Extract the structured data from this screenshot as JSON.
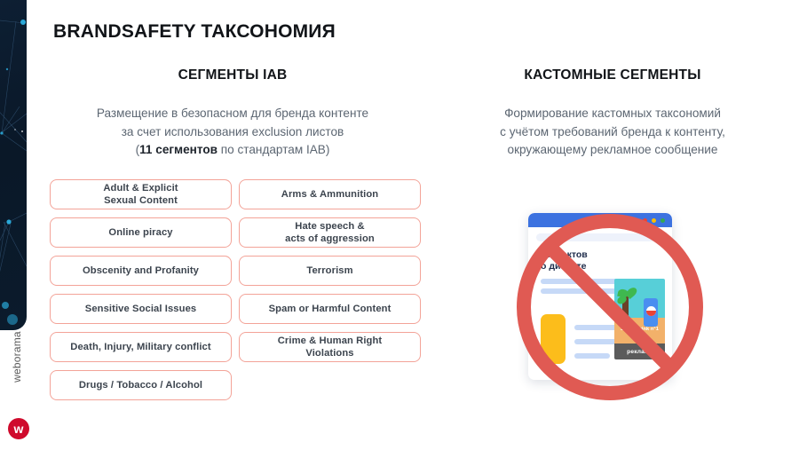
{
  "slide": {
    "title": "BRANDSAFETY ТАКСОНОМИЯ",
    "accent_border": "#f3a398",
    "accent_red": "#cf0a2c",
    "text_muted": "#5c6672"
  },
  "brand": {
    "name": "weborama",
    "mark_letter": "w",
    "mark_color": "#cf0a2c"
  },
  "columns": {
    "left": {
      "heading": "СЕГМЕНТЫ IAB",
      "description_line1": "Размещение в безопасном для бренда контенте",
      "description_line2": "за счет использования exclusion листов",
      "description_line3_prefix": "(",
      "description_line3_bold": "11 сегментов",
      "description_line3_suffix": " по стандартам IAB)",
      "segments_col1": [
        "Adult & Explicit\nSexual Content",
        "Online piracy",
        "Obscenity and Profanity",
        "Sensitive Social Issues",
        "Death, Injury, Military conflict",
        "Drugs / Tobacco / Alcohol"
      ],
      "segments_col2": [
        "Arms & Ammunition",
        "Hate speech &\nacts of aggression",
        "Terrorism",
        "Spam or Harmful Content",
        "Crime & Human Right\nViolations",
        ""
      ]
    },
    "right": {
      "heading": "КАСТОМНЫЕ СЕГМЕНТЫ",
      "description_line1": "Формирование кастомных таксономий",
      "description_line2": "с учётом требований бренда к контенту,",
      "description_line3": "окружающему рекламное сообщение"
    }
  },
  "illustration": {
    "article_title": "10 фактов\nо диабете",
    "ad_headline": "Sugar drink n°1",
    "ad_disclosure": "реклама",
    "prohibition_color": "#e05a53",
    "browser_bar_color": "#3c72e0",
    "dots": [
      "#ea4335",
      "#fbbc05",
      "#34a853"
    ]
  }
}
